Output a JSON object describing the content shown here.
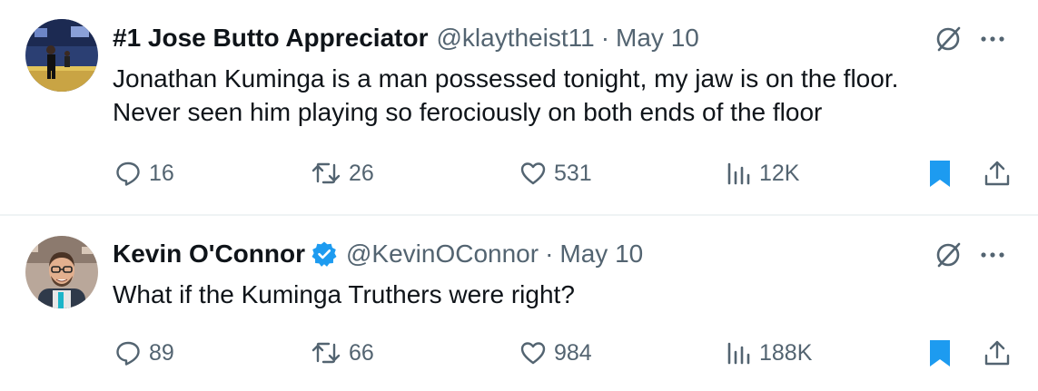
{
  "colors": {
    "text": "#0f1419",
    "muted": "#536471",
    "verified": "#1d9bf0",
    "bookmark": "#1d9bf0",
    "divider": "#eff3f4"
  },
  "tweets": [
    {
      "display_name": "#1 Jose Butto Appreciator",
      "verified": false,
      "handle": "@klaytheist11",
      "separator": "·",
      "date": "May 10",
      "lines": [
        "Jonathan Kuminga is a man possessed tonight, my jaw is on the floor.",
        "Never seen him playing so ferociously on both ends of the floor"
      ],
      "replies": "16",
      "reposts": "26",
      "likes": "531",
      "views": "12K",
      "bookmarked": true
    },
    {
      "display_name": "Kevin O'Connor",
      "verified": true,
      "handle": "@KevinOConnor",
      "separator": "·",
      "date": "May 10",
      "lines": [
        "What if the Kuminga Truthers were right?"
      ],
      "replies": "89",
      "reposts": "66",
      "likes": "984",
      "views": "188K",
      "bookmarked": true
    }
  ],
  "icons": [
    "grok-icon",
    "more-icon",
    "reply-icon",
    "repost-icon",
    "like-icon",
    "views-icon",
    "bookmark-icon",
    "share-icon",
    "verified-icon"
  ]
}
